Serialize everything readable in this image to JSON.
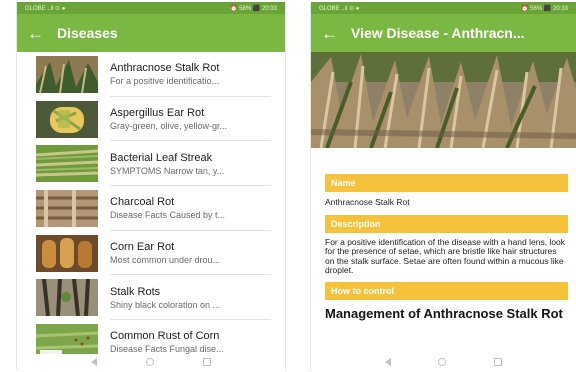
{
  "left_screen": {
    "status": {
      "left": "GLOBE ..il ⊙ ●",
      "right": "⏰ 58% ⬛ 20:33"
    },
    "app_bar": {
      "title": "Diseases"
    },
    "items": [
      {
        "title": "Anthracnose Stalk Rot",
        "subtitle": "For a positive identificatio..."
      },
      {
        "title": "Aspergillus Ear Rot",
        "subtitle": "Gray-green, olive, yellow-gr..."
      },
      {
        "title": "Bacterial Leaf Streak",
        "subtitle": "SYMPTOMS Narrow tan, y..."
      },
      {
        "title": "Charcoal Rot",
        "subtitle": "Disease Facts Caused by t..."
      },
      {
        "title": "Corn Ear Rot",
        "subtitle": "Most common under drou..."
      },
      {
        "title": "Stalk Rots",
        "subtitle": "Shiny black coloration on ..."
      },
      {
        "title": "Common Rust of Corn",
        "subtitle": "Disease Facts Fungal dise..."
      }
    ]
  },
  "right_screen": {
    "status": {
      "left": "GLOBE ..il ⊙ ●",
      "right": "⏰ 56% ⬛ 20:33"
    },
    "app_bar": {
      "title": "View Disease - Anthracn..."
    },
    "name_header": "Name",
    "name_value": "Anthracnose Stalk Rot",
    "description_header": "Description",
    "description_value": "For a positive identification of the disease with a hand lens, look for the presence of setae, which are bristle like hair structures on the stalk surface. Setae are often found within a mucous like droplet.",
    "control_header": "How to control",
    "control_title": "Management of Anthracnose Stalk Rot"
  },
  "icons": {
    "back": "arrow-back-icon",
    "nav_back": "nav-back-icon",
    "nav_home": "nav-home-icon",
    "nav_recent": "nav-recent-icon"
  },
  "colors": {
    "app_bar": "#7ab843",
    "status_bar": "#6aa436",
    "section_header": "#f6c23c"
  }
}
